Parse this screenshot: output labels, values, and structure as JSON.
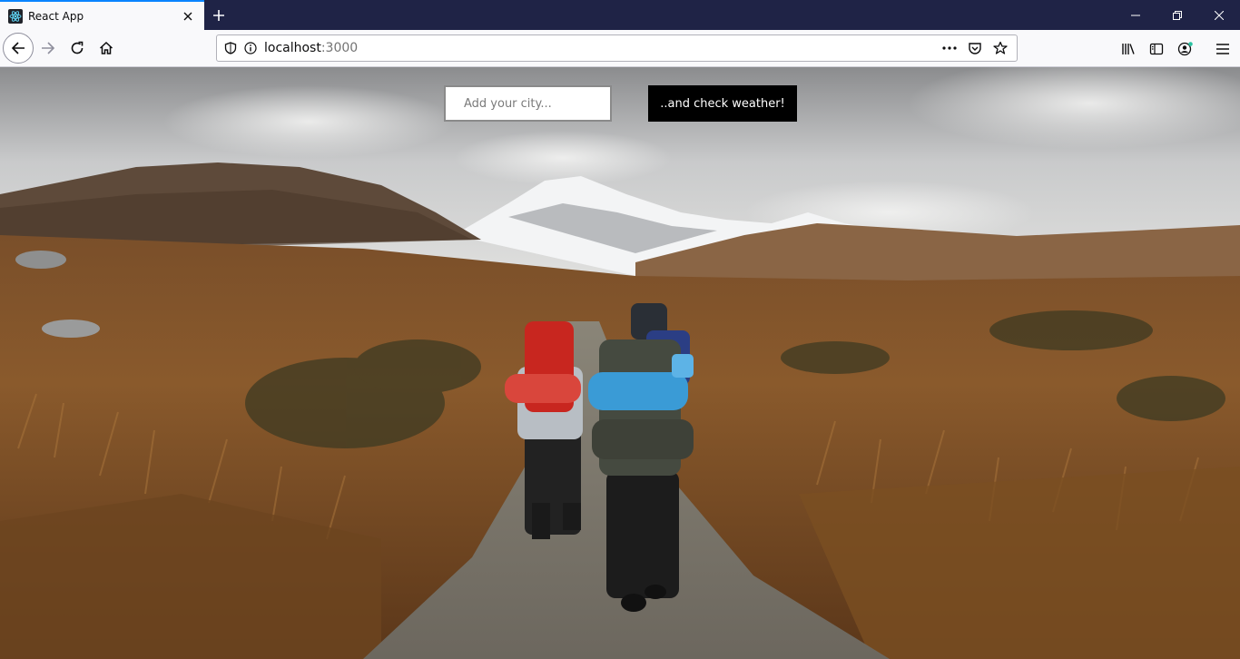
{
  "browser": {
    "tab": {
      "title": "React App",
      "favicon": "react-icon"
    },
    "new_tab_icon": "plus-icon",
    "window_controls": [
      "minimize-icon",
      "restore-icon",
      "close-icon"
    ],
    "url": {
      "host": "localhost",
      "port": ":3000"
    },
    "toolbar_icons": [
      "library-icon",
      "sidebar-icon",
      "account-icon",
      "menu-icon"
    ],
    "accent": "#0a84ff"
  },
  "app": {
    "city_input": {
      "placeholder": "Add your city...",
      "value": ""
    },
    "check_button": {
      "label": "..and check weather!"
    },
    "background_image": "Hikers with backpacks walking on a gravel path through moorland toward a snow-capped mountain"
  }
}
